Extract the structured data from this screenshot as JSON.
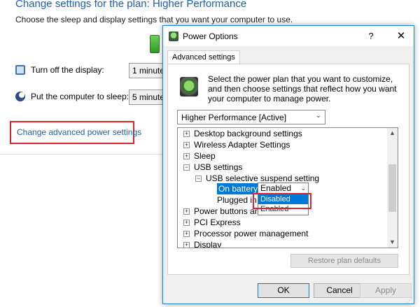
{
  "background": {
    "title": "Change settings for the plan: Higher Performance",
    "subtitle": "Choose the sleep and display settings that you want your computer to use.",
    "rows": [
      {
        "label": "Turn off the display:",
        "value": "1 minute"
      },
      {
        "label": "Put the computer to sleep:",
        "value": "5 minute"
      }
    ],
    "advanced_link": "Change advanced power settings"
  },
  "dialog": {
    "title": "Power Options",
    "help": "?",
    "close": "✕",
    "tab": "Advanced settings",
    "description": "Select the power plan that you want to customize, and then choose settings that reflect how you want your computer to manage power.",
    "plan": "Higher Performance [Active]",
    "tree": {
      "desktop_background": "Desktop background settings",
      "wireless": "Wireless Adapter Settings",
      "sleep": "Sleep",
      "usb": "USB settings",
      "usb_suspend": "USB selective suspend setting",
      "on_battery": "On battery:",
      "on_battery_value": "Enabled",
      "plugged_in": "Plugged in",
      "power_buttons": "Power buttons and",
      "pci": "PCI Express",
      "processor": "Processor power management",
      "display": "Display"
    },
    "dropdown": {
      "options": [
        "Disabled",
        "Enabled"
      ],
      "selected": "Disabled"
    },
    "restore": "Restore plan defaults",
    "ok": "OK",
    "cancel": "Cancel",
    "apply": "Apply"
  },
  "colors": {
    "accent": "#0078d7",
    "link": "#1e5fae",
    "callout": "#d9232d"
  }
}
